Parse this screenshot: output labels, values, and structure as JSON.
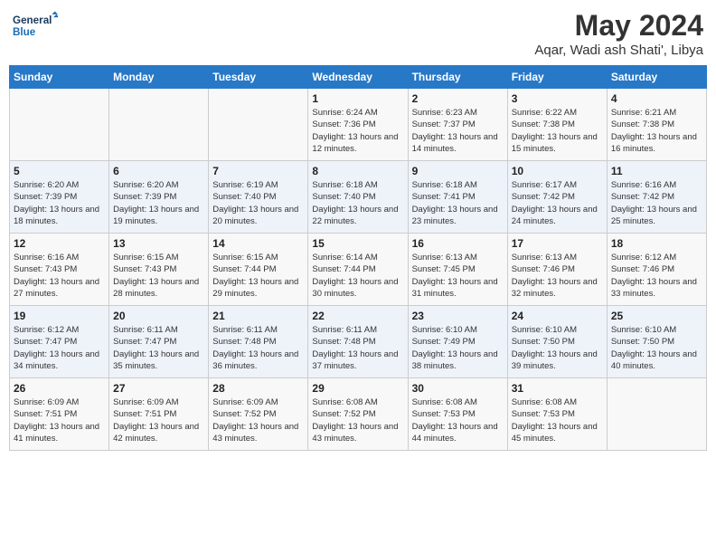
{
  "header": {
    "logo_line1": "General",
    "logo_line2": "Blue",
    "month_year": "May 2024",
    "location": "Aqar, Wadi ash Shati', Libya"
  },
  "weekdays": [
    "Sunday",
    "Monday",
    "Tuesday",
    "Wednesday",
    "Thursday",
    "Friday",
    "Saturday"
  ],
  "weeks": [
    [
      {
        "day": "",
        "sunrise": "",
        "sunset": "",
        "daylight": ""
      },
      {
        "day": "",
        "sunrise": "",
        "sunset": "",
        "daylight": ""
      },
      {
        "day": "",
        "sunrise": "",
        "sunset": "",
        "daylight": ""
      },
      {
        "day": "1",
        "sunrise": "Sunrise: 6:24 AM",
        "sunset": "Sunset: 7:36 PM",
        "daylight": "Daylight: 13 hours and 12 minutes."
      },
      {
        "day": "2",
        "sunrise": "Sunrise: 6:23 AM",
        "sunset": "Sunset: 7:37 PM",
        "daylight": "Daylight: 13 hours and 14 minutes."
      },
      {
        "day": "3",
        "sunrise": "Sunrise: 6:22 AM",
        "sunset": "Sunset: 7:38 PM",
        "daylight": "Daylight: 13 hours and 15 minutes."
      },
      {
        "day": "4",
        "sunrise": "Sunrise: 6:21 AM",
        "sunset": "Sunset: 7:38 PM",
        "daylight": "Daylight: 13 hours and 16 minutes."
      }
    ],
    [
      {
        "day": "5",
        "sunrise": "Sunrise: 6:20 AM",
        "sunset": "Sunset: 7:39 PM",
        "daylight": "Daylight: 13 hours and 18 minutes."
      },
      {
        "day": "6",
        "sunrise": "Sunrise: 6:20 AM",
        "sunset": "Sunset: 7:39 PM",
        "daylight": "Daylight: 13 hours and 19 minutes."
      },
      {
        "day": "7",
        "sunrise": "Sunrise: 6:19 AM",
        "sunset": "Sunset: 7:40 PM",
        "daylight": "Daylight: 13 hours and 20 minutes."
      },
      {
        "day": "8",
        "sunrise": "Sunrise: 6:18 AM",
        "sunset": "Sunset: 7:40 PM",
        "daylight": "Daylight: 13 hours and 22 minutes."
      },
      {
        "day": "9",
        "sunrise": "Sunrise: 6:18 AM",
        "sunset": "Sunset: 7:41 PM",
        "daylight": "Daylight: 13 hours and 23 minutes."
      },
      {
        "day": "10",
        "sunrise": "Sunrise: 6:17 AM",
        "sunset": "Sunset: 7:42 PM",
        "daylight": "Daylight: 13 hours and 24 minutes."
      },
      {
        "day": "11",
        "sunrise": "Sunrise: 6:16 AM",
        "sunset": "Sunset: 7:42 PM",
        "daylight": "Daylight: 13 hours and 25 minutes."
      }
    ],
    [
      {
        "day": "12",
        "sunrise": "Sunrise: 6:16 AM",
        "sunset": "Sunset: 7:43 PM",
        "daylight": "Daylight: 13 hours and 27 minutes."
      },
      {
        "day": "13",
        "sunrise": "Sunrise: 6:15 AM",
        "sunset": "Sunset: 7:43 PM",
        "daylight": "Daylight: 13 hours and 28 minutes."
      },
      {
        "day": "14",
        "sunrise": "Sunrise: 6:15 AM",
        "sunset": "Sunset: 7:44 PM",
        "daylight": "Daylight: 13 hours and 29 minutes."
      },
      {
        "day": "15",
        "sunrise": "Sunrise: 6:14 AM",
        "sunset": "Sunset: 7:44 PM",
        "daylight": "Daylight: 13 hours and 30 minutes."
      },
      {
        "day": "16",
        "sunrise": "Sunrise: 6:13 AM",
        "sunset": "Sunset: 7:45 PM",
        "daylight": "Daylight: 13 hours and 31 minutes."
      },
      {
        "day": "17",
        "sunrise": "Sunrise: 6:13 AM",
        "sunset": "Sunset: 7:46 PM",
        "daylight": "Daylight: 13 hours and 32 minutes."
      },
      {
        "day": "18",
        "sunrise": "Sunrise: 6:12 AM",
        "sunset": "Sunset: 7:46 PM",
        "daylight": "Daylight: 13 hours and 33 minutes."
      }
    ],
    [
      {
        "day": "19",
        "sunrise": "Sunrise: 6:12 AM",
        "sunset": "Sunset: 7:47 PM",
        "daylight": "Daylight: 13 hours and 34 minutes."
      },
      {
        "day": "20",
        "sunrise": "Sunrise: 6:11 AM",
        "sunset": "Sunset: 7:47 PM",
        "daylight": "Daylight: 13 hours and 35 minutes."
      },
      {
        "day": "21",
        "sunrise": "Sunrise: 6:11 AM",
        "sunset": "Sunset: 7:48 PM",
        "daylight": "Daylight: 13 hours and 36 minutes."
      },
      {
        "day": "22",
        "sunrise": "Sunrise: 6:11 AM",
        "sunset": "Sunset: 7:48 PM",
        "daylight": "Daylight: 13 hours and 37 minutes."
      },
      {
        "day": "23",
        "sunrise": "Sunrise: 6:10 AM",
        "sunset": "Sunset: 7:49 PM",
        "daylight": "Daylight: 13 hours and 38 minutes."
      },
      {
        "day": "24",
        "sunrise": "Sunrise: 6:10 AM",
        "sunset": "Sunset: 7:50 PM",
        "daylight": "Daylight: 13 hours and 39 minutes."
      },
      {
        "day": "25",
        "sunrise": "Sunrise: 6:10 AM",
        "sunset": "Sunset: 7:50 PM",
        "daylight": "Daylight: 13 hours and 40 minutes."
      }
    ],
    [
      {
        "day": "26",
        "sunrise": "Sunrise: 6:09 AM",
        "sunset": "Sunset: 7:51 PM",
        "daylight": "Daylight: 13 hours and 41 minutes."
      },
      {
        "day": "27",
        "sunrise": "Sunrise: 6:09 AM",
        "sunset": "Sunset: 7:51 PM",
        "daylight": "Daylight: 13 hours and 42 minutes."
      },
      {
        "day": "28",
        "sunrise": "Sunrise: 6:09 AM",
        "sunset": "Sunset: 7:52 PM",
        "daylight": "Daylight: 13 hours and 43 minutes."
      },
      {
        "day": "29",
        "sunrise": "Sunrise: 6:08 AM",
        "sunset": "Sunset: 7:52 PM",
        "daylight": "Daylight: 13 hours and 43 minutes."
      },
      {
        "day": "30",
        "sunrise": "Sunrise: 6:08 AM",
        "sunset": "Sunset: 7:53 PM",
        "daylight": "Daylight: 13 hours and 44 minutes."
      },
      {
        "day": "31",
        "sunrise": "Sunrise: 6:08 AM",
        "sunset": "Sunset: 7:53 PM",
        "daylight": "Daylight: 13 hours and 45 minutes."
      },
      {
        "day": "",
        "sunrise": "",
        "sunset": "",
        "daylight": ""
      }
    ]
  ]
}
